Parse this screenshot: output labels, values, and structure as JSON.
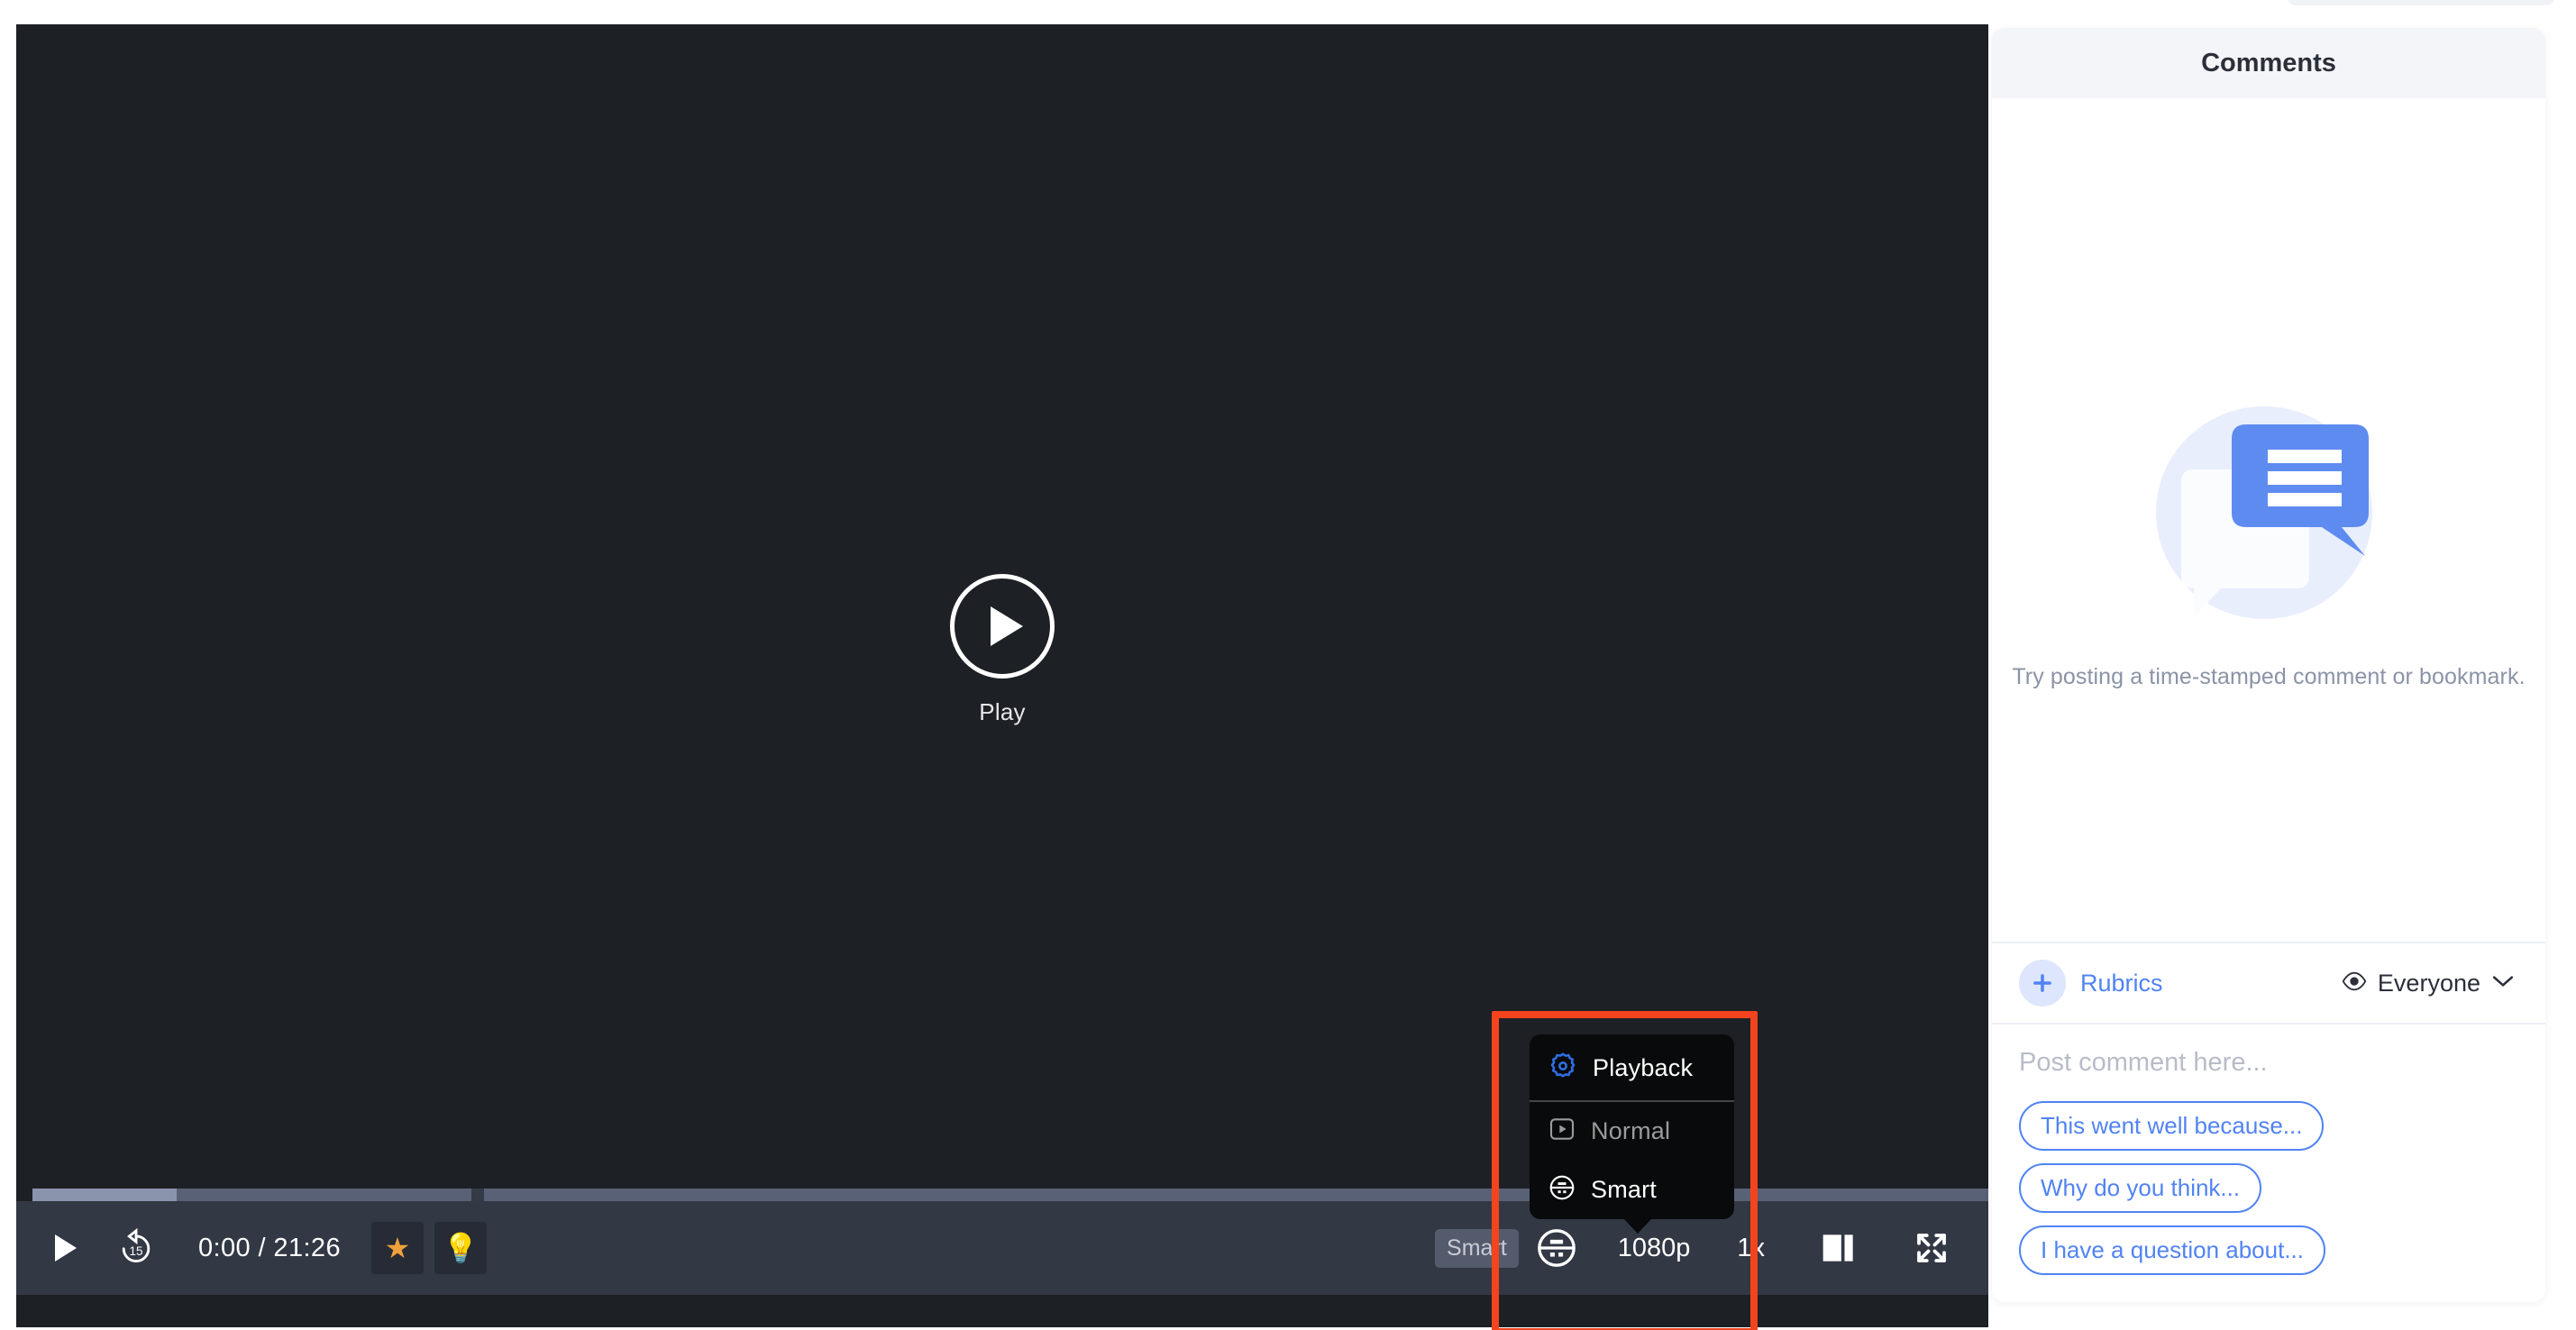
{
  "player": {
    "center_play": {
      "icon": "play-icon",
      "label": "Play"
    },
    "controls": {
      "play_icon": "play-icon",
      "rewind_icon": "rewind-15-icon",
      "rewind_seconds": "15",
      "time_display": "0:00 / 21:26",
      "current_time": "0:00",
      "duration": "21:26",
      "star_icon": "star-emoji",
      "star_glyph": "★",
      "bulb_icon": "lightbulb-emoji",
      "bulb_glyph": "💡",
      "smart_badge": "Smart",
      "smart_toggle_icon": "smart-playback-icon",
      "resolution": "1080p",
      "speed": "1x",
      "theater_icon": "theater-mode-icon",
      "fullscreen_icon": "fullscreen-icon"
    },
    "progress": {
      "played_percent": 0,
      "buffered_percent": 7
    }
  },
  "playback_menu": {
    "header": {
      "icon": "gear-icon",
      "label": "Playback"
    },
    "items": [
      {
        "label": "Normal",
        "icon": "normal-playback-icon",
        "selected": false
      },
      {
        "label": "Smart",
        "icon": "smart-playback-icon",
        "selected": true
      }
    ]
  },
  "annotation": {
    "highlight_color": "#f4441e"
  },
  "comments": {
    "title": "Comments",
    "empty_state": {
      "illustration": "comment-bubbles-illustration",
      "text": "Try posting a time-stamped comment or bookmark."
    },
    "rubrics": {
      "plus_icon": "plus-icon",
      "label": "Rubrics"
    },
    "visibility": {
      "eye_icon": "eye-icon",
      "label": "Everyone",
      "chevron_icon": "chevron-down-icon"
    },
    "input": {
      "placeholder": "Post comment here...",
      "value": ""
    },
    "suggestion_chips": [
      "This went well because...",
      "Why do you think...",
      "I have a question about..."
    ]
  },
  "colors": {
    "accent_blue": "#5183f4",
    "player_bg": "#1d2025",
    "control_bar": "#323844",
    "menu_bg": "#090a0b",
    "highlight_red": "#f4441e"
  }
}
